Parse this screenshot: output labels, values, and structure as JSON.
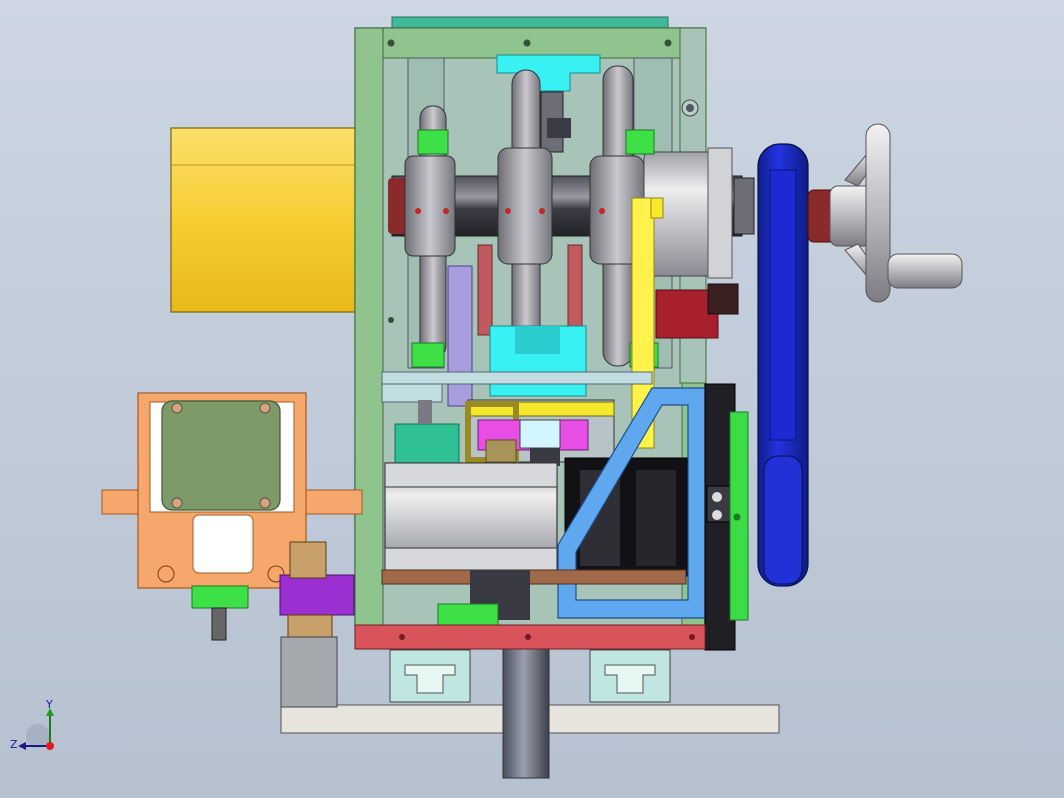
{
  "viewport": {
    "background_top": "#cdd6e2",
    "background_bottom": "#b6c1d0"
  },
  "colors": {
    "frame_green": "#8fc48e",
    "motor_yellow": "#f9d23c",
    "belt_blue": "#1f2fd6",
    "base_red": "#d9535a",
    "cyan_block": "#37f1f2",
    "orange_bracket": "#f6a86c",
    "stepper_olive": "#7d9a68",
    "purple_clamp": "#9b2fd1",
    "handwheel_grey": "#c8c8cc",
    "light_blue_arm": "#5fa8ef"
  },
  "icons": {
    "triad": "coordinate-triad-icon"
  },
  "triad": {
    "y_label": "Y",
    "z_label": "Z"
  }
}
